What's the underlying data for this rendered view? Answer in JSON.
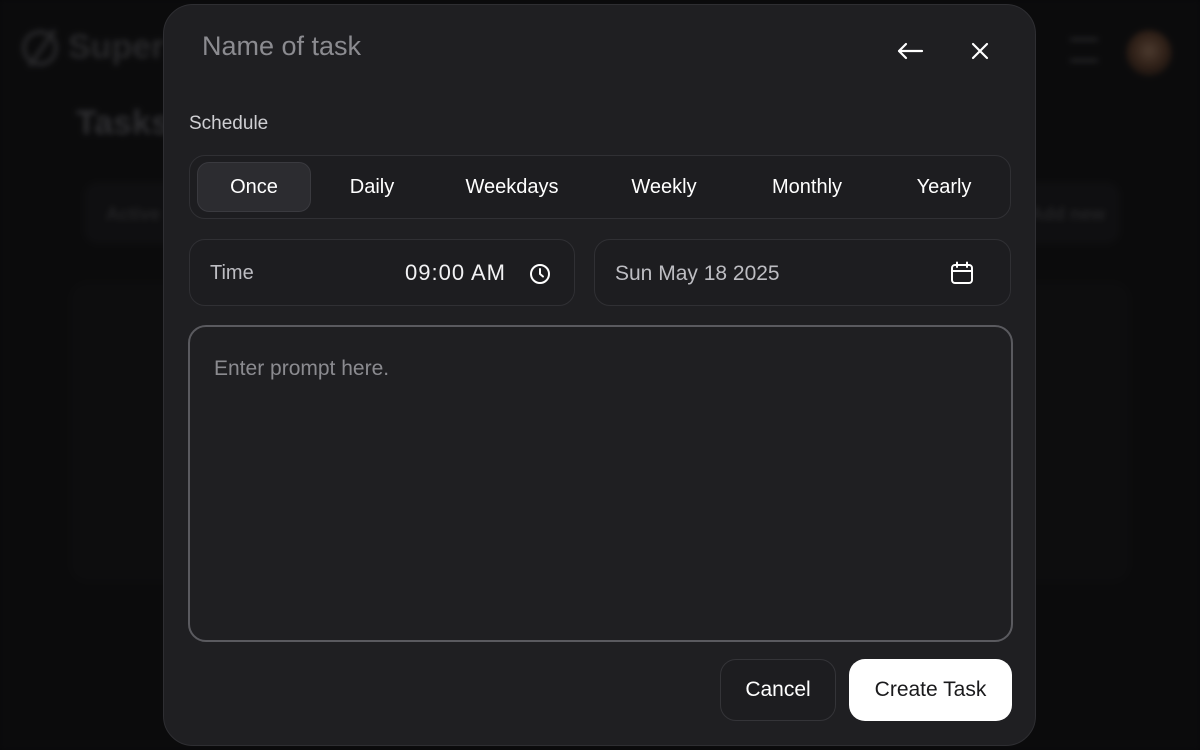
{
  "background": {
    "brand": "Super",
    "page_title": "Tasks",
    "tab_active": "Active",
    "add_new": "Add new"
  },
  "modal": {
    "task_name_placeholder": "Name of task",
    "back_icon": "arrow-left-icon",
    "close_icon": "close-icon",
    "schedule_label": "Schedule",
    "schedule_options": [
      "Once",
      "Daily",
      "Weekdays",
      "Weekly",
      "Monthly",
      "Yearly"
    ],
    "schedule_selected": "Once",
    "time": {
      "label": "Time",
      "value": "09:00 AM",
      "icon": "clock-icon"
    },
    "date": {
      "value": "Sun May 18 2025",
      "icon": "calendar-icon"
    },
    "prompt_placeholder": "Enter prompt here.",
    "cancel_label": "Cancel",
    "create_label": "Create Task"
  },
  "colors": {
    "modal_bg": "#1f1f22",
    "primary_button_bg": "#ffffff",
    "text_muted": "#8b8b90"
  }
}
